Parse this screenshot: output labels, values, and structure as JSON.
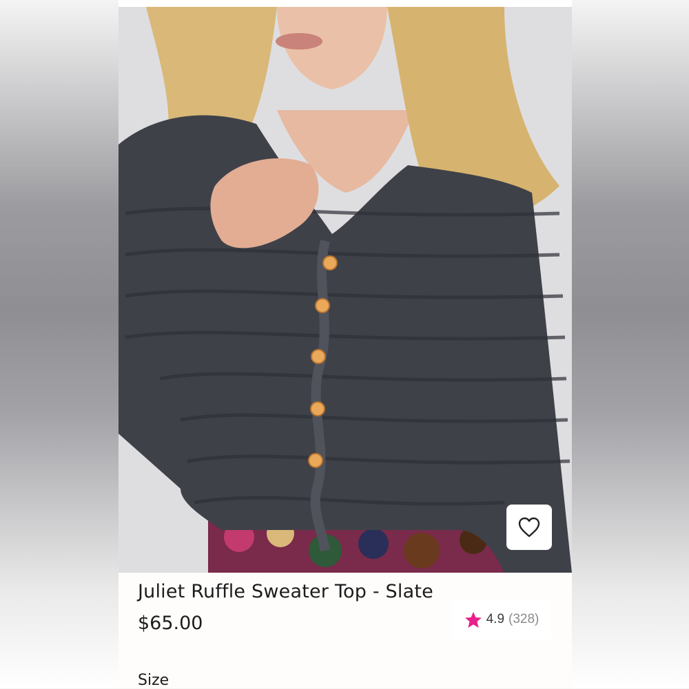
{
  "product": {
    "title": "Juliet Ruffle Sweater Top - Slate",
    "price": "$65.00",
    "rating": {
      "value": "4.9",
      "count": "(328)",
      "star_color": "#e8208a"
    },
    "size_label": "Size",
    "wishlist_icon": "heart-outline-icon"
  },
  "colors": {
    "sweater": "#3f4149",
    "button": "#e9a85a",
    "hair": "#d9b878"
  }
}
